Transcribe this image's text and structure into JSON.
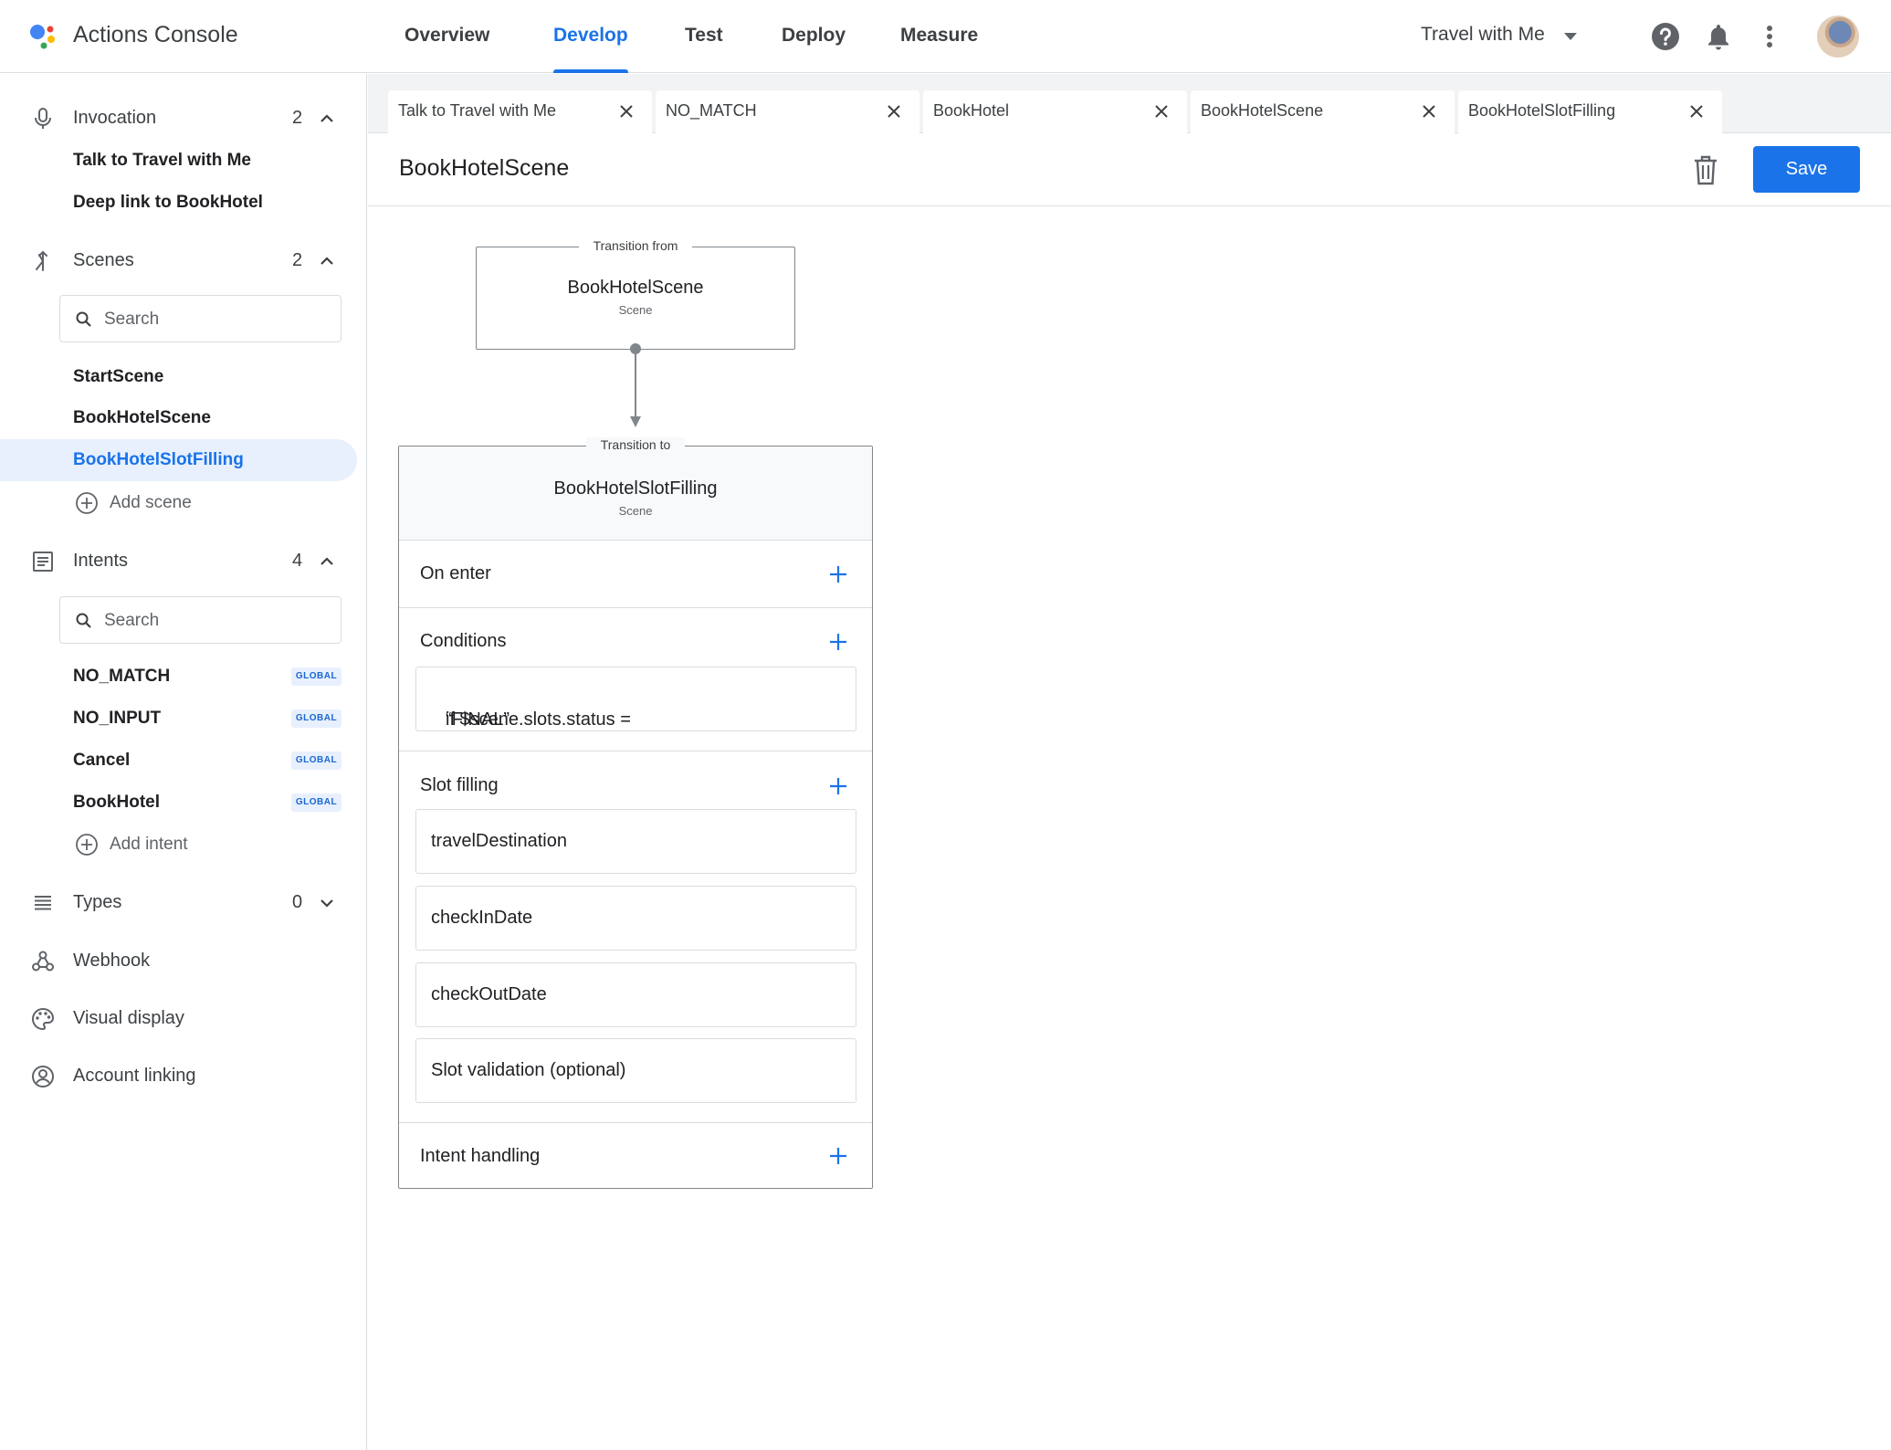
{
  "app": {
    "title": "Actions Console"
  },
  "nav": {
    "tabs": [
      {
        "label": "Overview"
      },
      {
        "label": "Develop"
      },
      {
        "label": "Test"
      },
      {
        "label": "Deploy"
      },
      {
        "label": "Measure"
      }
    ],
    "active": "Develop",
    "project": "Travel with Me"
  },
  "colors": {
    "accent": "#1a73e8",
    "selected_bg": "#e8f0fe",
    "string_literal": "#a01fb8"
  },
  "sidebar": {
    "invocation": {
      "label": "Invocation",
      "count": "2",
      "items": [
        "Talk to Travel with Me",
        "Deep link to BookHotel"
      ]
    },
    "scenes": {
      "label": "Scenes",
      "count": "2",
      "search_placeholder": "Search",
      "items": [
        "StartScene",
        "BookHotelScene",
        "BookHotelSlotFilling"
      ],
      "selected": "BookHotelSlotFilling",
      "add_label": "Add scene"
    },
    "intents": {
      "label": "Intents",
      "count": "4",
      "search_placeholder": "Search",
      "items": [
        {
          "name": "NO_MATCH",
          "badge": "GLOBAL"
        },
        {
          "name": "NO_INPUT",
          "badge": "GLOBAL"
        },
        {
          "name": "Cancel",
          "badge": "GLOBAL"
        },
        {
          "name": "BookHotel",
          "badge": "GLOBAL"
        }
      ],
      "add_label": "Add intent"
    },
    "types": {
      "label": "Types",
      "count": "0"
    },
    "webhook": {
      "label": "Webhook"
    },
    "visual_display": {
      "label": "Visual display"
    },
    "account_linking": {
      "label": "Account linking"
    }
  },
  "editor_tabs": [
    {
      "label": "Talk to Travel with Me"
    },
    {
      "label": "NO_MATCH"
    },
    {
      "label": "BookHotel"
    },
    {
      "label": "BookHotelScene"
    },
    {
      "label": "BookHotelSlotFilling"
    }
  ],
  "editor": {
    "title": "BookHotelScene",
    "save_label": "Save",
    "transition_from": {
      "legend": "Transition from",
      "name": "BookHotelScene",
      "type": "Scene"
    },
    "transition_to": {
      "legend": "Transition to",
      "name": "BookHotelSlotFilling",
      "type": "Scene"
    },
    "sections": {
      "on_enter": "On enter",
      "conditions": "Conditions",
      "condition_expr": "if $scene.slots.status = ",
      "condition_value": "“FINAL”",
      "slot_filling": "Slot filling",
      "slots": [
        "travelDestination",
        "checkInDate",
        "checkOutDate"
      ],
      "slot_validation": "Slot validation (optional)",
      "intent_handling": "Intent handling"
    }
  }
}
